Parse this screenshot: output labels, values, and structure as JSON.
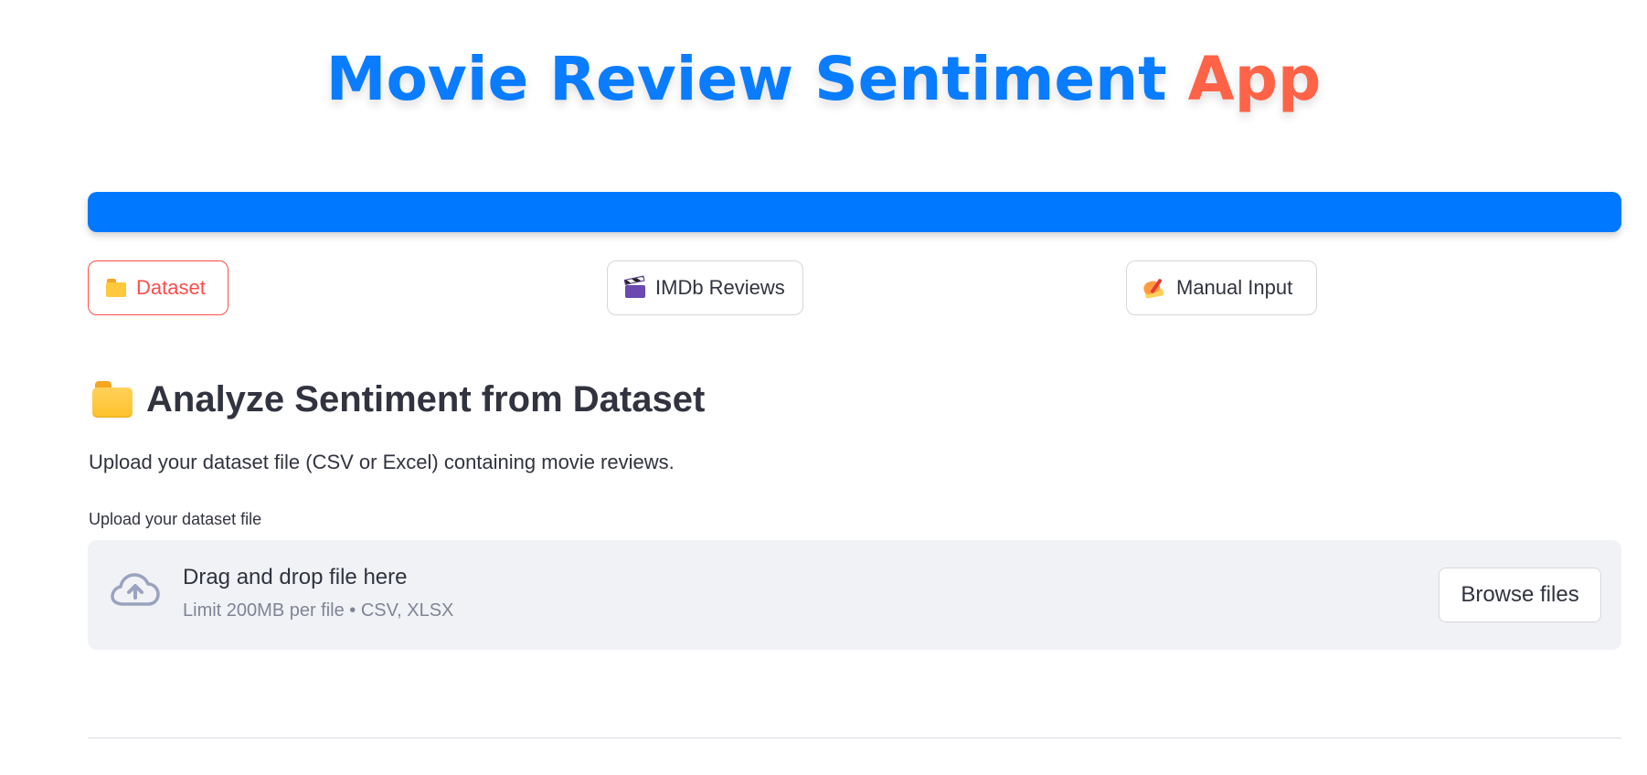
{
  "header": {
    "title_main": "Movie Review Sentiment",
    "title_accent": "App"
  },
  "nav": {
    "items": [
      {
        "label": "Dataset",
        "icon": "folder-icon",
        "active": true
      },
      {
        "label": "IMDb Reviews",
        "icon": "clapper-board-icon",
        "active": false
      },
      {
        "label": "Manual Input",
        "icon": "writing-hand-icon",
        "active": false
      }
    ]
  },
  "section": {
    "title": "Analyze Sentiment from Dataset",
    "title_icon": "folder-icon",
    "description": "Upload your dataset file (CSV or Excel) containing movie reviews."
  },
  "uploader": {
    "label": "Upload your dataset file",
    "icon": "cloud-upload-icon",
    "drag_text": "Drag and drop file here",
    "limit_text": "Limit 200MB per file • CSV, XLSX",
    "browse_label": "Browse files"
  },
  "colors": {
    "primary": "#0a7cff",
    "accent": "#ff6347",
    "active_tab": "#ff4b4b",
    "banner": "#0078ff",
    "upload_bg": "#f0f2f6"
  }
}
